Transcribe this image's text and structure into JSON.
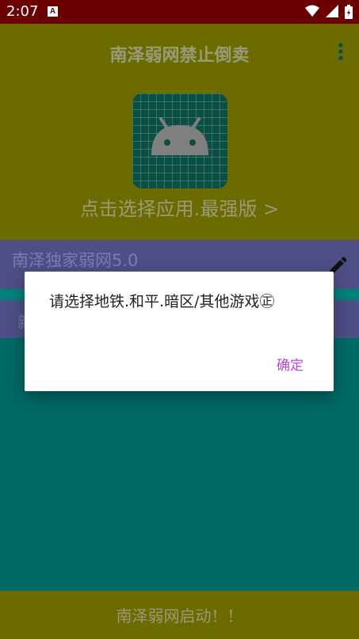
{
  "status_bar": {
    "time": "2:07",
    "notification_icon": "A"
  },
  "header": {
    "title": "南泽弱网禁止倒卖",
    "choose_app_label": "点击选择应用.最强版 >"
  },
  "row1": {
    "label": "南泽独家弱网5.0"
  },
  "row2": {
    "label": "新"
  },
  "footer": {
    "start_button": "南泽弱网启动！！"
  },
  "dialog": {
    "message": "请选择地铁.和平.暗区/其他游戏㊣",
    "ok_button": "确定"
  },
  "colors": {
    "status_bar": "#6b0000",
    "header": "#6b6b00",
    "background": "#006a66",
    "rows": "#4f4f87",
    "accent": "#b347d6"
  }
}
